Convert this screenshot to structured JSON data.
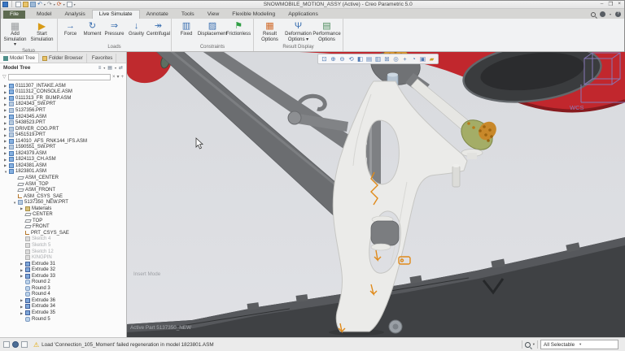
{
  "title_bar": {
    "title": "SNOWMOBILE_MOTION_ASSY (Active) - Creo Parametric 5.0"
  },
  "window_controls": {
    "minimize": "–",
    "restore": "❐",
    "close": "×"
  },
  "tabs": [
    {
      "label": "File",
      "state": "file",
      "name": "tab-file"
    },
    {
      "label": "Model",
      "state": "",
      "name": "tab-model"
    },
    {
      "label": "Analysis",
      "state": "",
      "name": "tab-analysis"
    },
    {
      "label": "Live Simulate",
      "state": "active",
      "name": "tab-live-simulate"
    },
    {
      "label": "Annotate",
      "state": "",
      "name": "tab-annotate"
    },
    {
      "label": "Tools",
      "state": "",
      "name": "tab-tools"
    },
    {
      "label": "View",
      "state": "",
      "name": "tab-view"
    },
    {
      "label": "Flexible Modeling",
      "state": "",
      "name": "tab-flexible-modeling"
    },
    {
      "label": "Applications",
      "state": "",
      "name": "tab-applications"
    }
  ],
  "ribbon": {
    "groups": [
      {
        "label": "Setup",
        "buttons": [
          {
            "label": "Add Simulation ▾",
            "icon": "ic-addsim",
            "name": "add-simulation-button"
          },
          {
            "label": "Start Simulation",
            "icon": "ic-startsim",
            "name": "start-simulation-button"
          }
        ]
      },
      {
        "label": "Loads",
        "buttons": [
          {
            "label": "Force",
            "icon": "ic-force",
            "name": "force-button"
          },
          {
            "label": "Moment",
            "icon": "ic-moment",
            "name": "moment-button"
          },
          {
            "label": "Pressure",
            "icon": "ic-pressure",
            "name": "pressure-button"
          },
          {
            "label": "Gravity",
            "icon": "ic-gravity",
            "name": "gravity-button"
          },
          {
            "label": "Centrifugal",
            "icon": "ic-centrifugal",
            "name": "centrifugal-button"
          }
        ]
      },
      {
        "label": "Constraints",
        "buttons": [
          {
            "label": "Fixed",
            "icon": "ic-fixed",
            "name": "fixed-button"
          },
          {
            "label": "Displacement",
            "icon": "ic-displacement",
            "name": "displacement-button"
          },
          {
            "label": "Frictionless",
            "icon": "ic-frictionless",
            "name": "frictionless-button"
          }
        ]
      },
      {
        "label": "Result Display",
        "buttons": [
          {
            "label": "Result Options",
            "icon": "ic-resultopt",
            "name": "result-options-button"
          },
          {
            "label": "Deformation Options ▾",
            "icon": "ic-deform",
            "name": "deformation-options-button"
          },
          {
            "label": "Performance Options",
            "icon": "ic-perf",
            "name": "performance-options-button"
          }
        ]
      }
    ]
  },
  "panel": {
    "tabs": [
      {
        "label": "Model Tree",
        "icon": "tree",
        "state": "active",
        "name": "panel-tab-model-tree"
      },
      {
        "label": "Folder Browser",
        "icon": "folder",
        "state": "",
        "name": "panel-tab-folder-browser"
      },
      {
        "label": "Favorites",
        "icon": "star",
        "state": "",
        "name": "panel-tab-favorites"
      }
    ],
    "header": {
      "title": "Model Tree"
    },
    "filter": {
      "value": ""
    }
  },
  "tree": [
    {
      "label": "0111307_INTAKE.ASM",
      "ind": "ind0",
      "icon": "i-asm",
      "tw": "▶",
      "st": ""
    },
    {
      "label": "0111312_CONSOLE.ASM",
      "ind": "ind0",
      "icon": "i-asm",
      "tw": "▶",
      "st": ""
    },
    {
      "label": "0111313_FR_BUMP.ASM",
      "ind": "ind0",
      "icon": "i-asm",
      "tw": "▶",
      "st": ""
    },
    {
      "label": "1824343_SW.PRT",
      "ind": "ind0",
      "icon": "i-prt",
      "tw": "▶",
      "st": ""
    },
    {
      "label": "5137356.PRT",
      "ind": "ind0",
      "icon": "i-prt",
      "tw": "▶",
      "st": ""
    },
    {
      "label": "1824345.ASM",
      "ind": "ind0",
      "icon": "i-asm",
      "tw": "▶",
      "st": ""
    },
    {
      "label": "5438523.PRT",
      "ind": "ind0",
      "icon": "i-prt",
      "tw": "▶",
      "st": ""
    },
    {
      "label": "DRIVER_COG.PRT",
      "ind": "ind0",
      "icon": "i-prt",
      "tw": "▶",
      "st": ""
    },
    {
      "label": "5451519.PRT",
      "ind": "ind0",
      "icon": "i-prt",
      "tw": "▶",
      "st": ""
    },
    {
      "label": "114010_AFS_RNK144_IFS.ASM",
      "ind": "ind0",
      "icon": "i-asm",
      "tw": "▶",
      "st": ""
    },
    {
      "label": "1590551_SW.PRT",
      "ind": "ind0",
      "icon": "i-prt",
      "tw": "▶",
      "st": ""
    },
    {
      "label": "1824379.ASM",
      "ind": "ind0",
      "icon": "i-asm",
      "tw": "▶",
      "st": ""
    },
    {
      "label": "1824113_CH.ASM",
      "ind": "ind0",
      "icon": "i-asm",
      "tw": "▶",
      "st": ""
    },
    {
      "label": "1824381.ASM",
      "ind": "ind0",
      "icon": "i-asm",
      "tw": "▶",
      "st": ""
    },
    {
      "label": "1823801.ASM",
      "ind": "ind0",
      "icon": "i-asm",
      "tw": "▼",
      "st": ""
    },
    {
      "label": "ASM_CENTER",
      "ind": "ind1",
      "icon": "i-datum",
      "tw": "",
      "st": ""
    },
    {
      "label": "ASM_TOP",
      "ind": "ind1",
      "icon": "i-datum",
      "tw": "",
      "st": ""
    },
    {
      "label": "ASM_FRONT",
      "ind": "ind1",
      "icon": "i-datum",
      "tw": "",
      "st": ""
    },
    {
      "label": "ASM_CSYS_SAE",
      "ind": "ind1",
      "icon": "i-csys",
      "tw": "",
      "st": ""
    },
    {
      "label": "5137350_NEW.PRT",
      "ind": "ind1",
      "icon": "i-prt",
      "tw": "▼",
      "st": ""
    },
    {
      "label": "Materials",
      "ind": "ind2",
      "icon": "i-mat",
      "tw": "▶",
      "st": ""
    },
    {
      "label": "CENTER",
      "ind": "ind2",
      "icon": "i-datum",
      "tw": "",
      "st": ""
    },
    {
      "label": "TOP",
      "ind": "ind2",
      "icon": "i-datum",
      "tw": "",
      "st": ""
    },
    {
      "label": "FRONT",
      "ind": "ind2",
      "icon": "i-datum",
      "tw": "",
      "st": ""
    },
    {
      "label": "PRT_CSYS_SAE",
      "ind": "ind2",
      "icon": "i-csys",
      "tw": "",
      "st": ""
    },
    {
      "label": "Sketch 4",
      "ind": "ind2",
      "icon": "i-sketch",
      "tw": "",
      "st": "grayed"
    },
    {
      "label": "Sketch 5",
      "ind": "ind2",
      "icon": "i-sketch",
      "tw": "",
      "st": "grayed"
    },
    {
      "label": "Sketch 12",
      "ind": "ind2",
      "icon": "i-sketch",
      "tw": "",
      "st": "grayed"
    },
    {
      "label": "KINGPIN",
      "ind": "ind2",
      "icon": "i-sketch",
      "tw": "",
      "st": "grayed"
    },
    {
      "label": "Extrude 31",
      "ind": "ind2",
      "icon": "i-extrude",
      "tw": "▶",
      "st": ""
    },
    {
      "label": "Extrude 32",
      "ind": "ind2",
      "icon": "i-extrude",
      "tw": "▶",
      "st": ""
    },
    {
      "label": "Extrude 33",
      "ind": "ind2",
      "icon": "i-extrude",
      "tw": "▶",
      "st": ""
    },
    {
      "label": "Round 2",
      "ind": "ind2",
      "icon": "i-round",
      "tw": "",
      "st": ""
    },
    {
      "label": "Round 3",
      "ind": "ind2",
      "icon": "i-round",
      "tw": "",
      "st": ""
    },
    {
      "label": "Round 4",
      "ind": "ind2",
      "icon": "i-round",
      "tw": "",
      "st": ""
    },
    {
      "label": "Extrude 36",
      "ind": "ind2",
      "icon": "i-extrude",
      "tw": "▶",
      "st": ""
    },
    {
      "label": "Extrude 34",
      "ind": "ind2",
      "icon": "i-extrude",
      "tw": "▶",
      "st": ""
    },
    {
      "label": "Extrude 35",
      "ind": "ind2",
      "icon": "i-extrude",
      "tw": "▶",
      "st": ""
    },
    {
      "label": "Round 5",
      "ind": "ind2",
      "icon": "i-round",
      "tw": "",
      "st": ""
    }
  ],
  "viewport": {
    "insert_mode": "Insert Mode",
    "active_part": "Active Part 5137350_NEW",
    "wcs": "WCS",
    "toolbar": [
      {
        "name": "refit-icon",
        "glyph": "⊡"
      },
      {
        "name": "zoom-in-icon",
        "glyph": "⊕"
      },
      {
        "name": "zoom-out-icon",
        "glyph": "⊖"
      },
      {
        "name": "repaint-icon",
        "glyph": "⟲"
      },
      {
        "name": "display-style-icon",
        "glyph": "◧"
      },
      {
        "name": "saved-orientations-icon",
        "glyph": "▤"
      },
      {
        "name": "view-manager-icon",
        "glyph": "▥"
      },
      {
        "name": "datum-display-icon",
        "glyph": "⊞"
      },
      {
        "name": "annotation-display-icon",
        "glyph": "◎"
      },
      {
        "name": "spin-center-icon",
        "glyph": "+"
      },
      {
        "name": "perspective-icon",
        "glyph": "◔"
      },
      {
        "name": "3d-box-icon",
        "glyph": "▣"
      },
      {
        "name": "sim-display-icon",
        "glyph": "▰"
      }
    ]
  },
  "status_bar": {
    "message": "Load 'Connection_105_Moment' failed regeneration in model 1823801.ASM",
    "select_filter": "All Selectable"
  },
  "colors": {
    "body_red": "#c1272d",
    "highlight_orange": "#e08a1a",
    "joint_green": "#a4ad67",
    "viewport_background": "#dcdee3",
    "warning_yellow": "#e3a700"
  }
}
